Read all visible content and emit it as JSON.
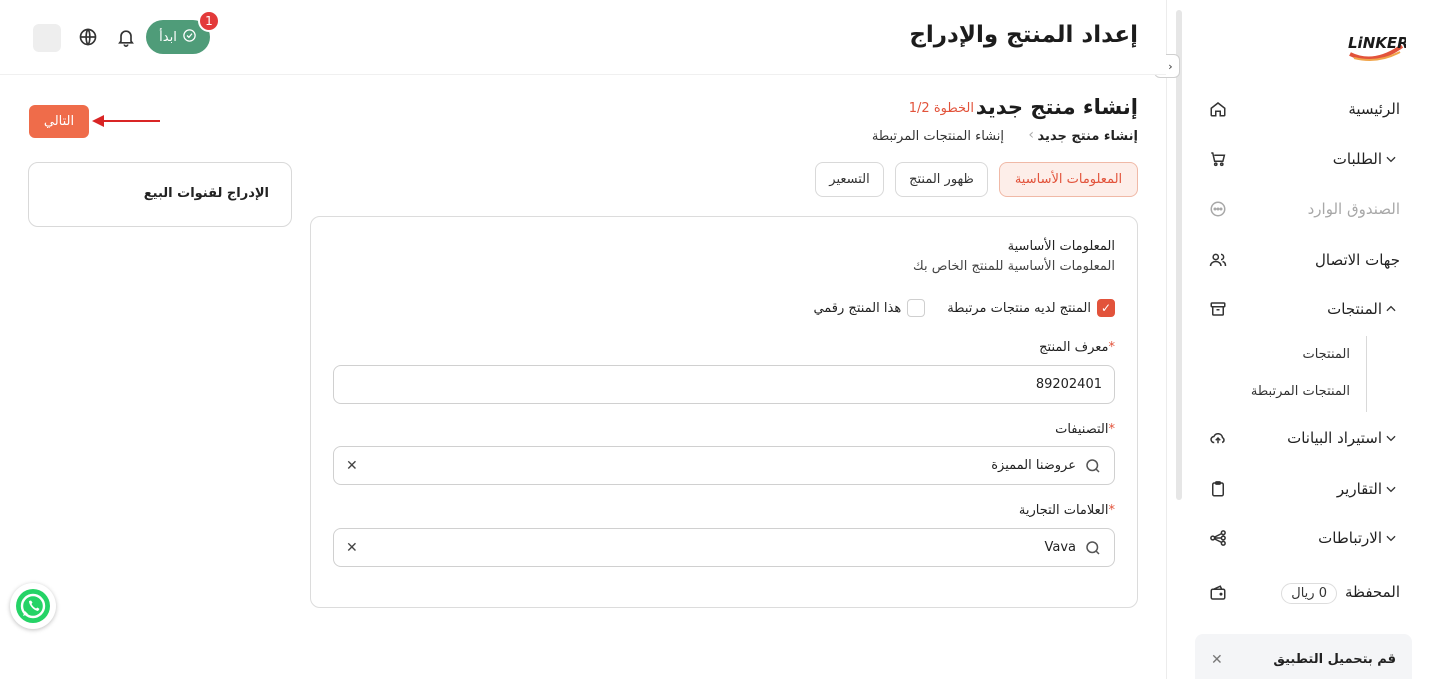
{
  "header": {
    "title": "إعداد المنتج والإدراج",
    "start_label": "ابدأ",
    "notification_count": "1"
  },
  "sidebar": {
    "logo_text": "LiNKER",
    "items": {
      "home": "الرئيسية",
      "orders": "الطلبات",
      "inbox": "الصندوق الوارد",
      "contacts": "جهات الاتصال",
      "products": "المنتجات",
      "sub_products": "المنتجات",
      "sub_related": "المنتجات المرتبطة",
      "import": "استيراد البيانات",
      "reports": "التقارير",
      "integrations": "الارتباطات",
      "wallet": "المحفظة",
      "wallet_balance": "0 ريال"
    },
    "promo_title": "قم بتحميل التطبيق"
  },
  "main": {
    "heading": "إنشاء منتج جديد",
    "step": "الخطوة 1/2",
    "breadcrumb": {
      "current": "إنشاء منتج جديد",
      "next": "إنشاء المنتجات المرتبطة"
    },
    "tabs": {
      "basic": "المعلومات الأساسية",
      "appearance": "ظهور المنتج",
      "pricing": "التسعير"
    },
    "section_title": "المعلومات الأساسية",
    "section_sub": "المعلومات الأساسية للمنتج الخاص بك",
    "checkbox_related": "المنتج لديه منتجات مرتبطة",
    "checkbox_digital": "هذا المنتج رقمي",
    "fields": {
      "product_id_label": "معرف المنتج",
      "product_id_value": "89202401",
      "categories_label": "التصنيفات",
      "categories_value": "عروضنا المميزة",
      "brands_label": "العلامات التجارية",
      "brands_value": "Vava",
      "required_mark": "*"
    },
    "next_label": "التالي",
    "channels_label": "الإدراج لقنوات البيع"
  },
  "colors": {
    "accent": "#e2533b",
    "start_green": "#4f9c79",
    "badge_red": "#e33a3a"
  }
}
